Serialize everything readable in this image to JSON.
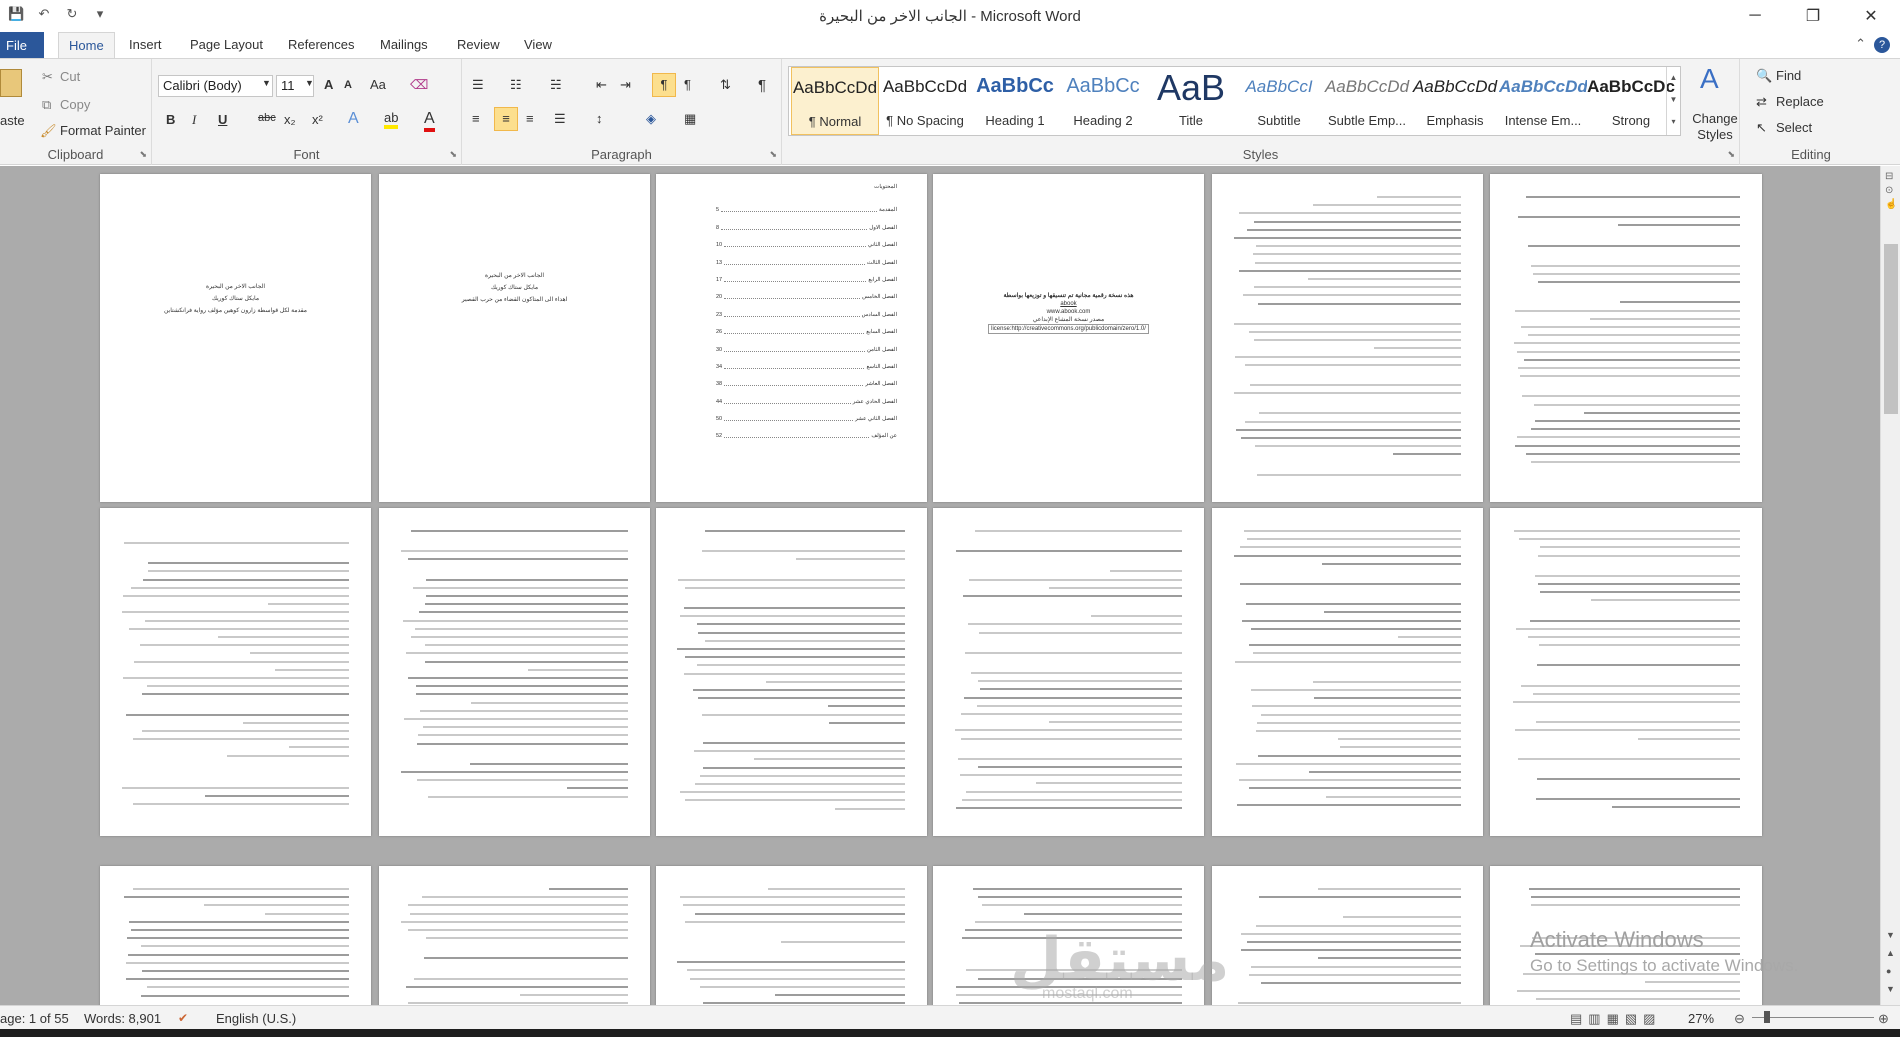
{
  "window": {
    "title": "الجانب الاخر من البحيرة  -  Microsoft Word",
    "controls": {
      "minimize": "─",
      "restore": "❐",
      "close": "✕"
    }
  },
  "qat": {
    "save_icon": "save-icon",
    "undo_icon": "undo-icon",
    "redo_icon": "redo-icon"
  },
  "tabs": {
    "file": "File",
    "home": "Home",
    "items": [
      "Insert",
      "Page Layout",
      "References",
      "Mailings",
      "Review",
      "View"
    ]
  },
  "ribbon": {
    "clipboard": {
      "paste": "aste",
      "cut": "Cut",
      "copy": "Copy",
      "format_painter": "Format Painter",
      "label": "Clipboard"
    },
    "font": {
      "font_name": "Calibri (Body)",
      "font_size": "11",
      "bold": "B",
      "italic": "I",
      "underline": "U",
      "strike": "abc",
      "subscript": "x₂",
      "superscript": "x²",
      "grow": "A",
      "shrink": "A",
      "case": "Aa",
      "label": "Font"
    },
    "paragraph": {
      "label": "Paragraph",
      "show_marks": "¶"
    },
    "styles": {
      "items": [
        {
          "preview": "AaBbCcDd",
          "name": "¶ Normal",
          "selected": true
        },
        {
          "preview": "AaBbCcDd",
          "name": "¶ No Spacing"
        },
        {
          "preview": "AaBbCc",
          "name": "Heading 1"
        },
        {
          "preview": "AaBbCc",
          "name": "Heading 2"
        },
        {
          "preview": "AaB",
          "name": "Title"
        },
        {
          "preview": "AaBbCcI",
          "name": "Subtitle"
        },
        {
          "preview": "AaBbCcDd",
          "name": "Subtle Emp..."
        },
        {
          "preview": "AaBbCcDd",
          "name": "Emphasis"
        },
        {
          "preview": "AaBbCcDd",
          "name": "Intense Em..."
        },
        {
          "preview": "AaBbCcDc",
          "name": "Strong"
        }
      ],
      "change_styles": "Change Styles",
      "label": "Styles"
    },
    "editing": {
      "find": "Find",
      "replace": "Replace",
      "select": "Select",
      "label": "Editing"
    }
  },
  "document": {
    "title_page": {
      "line1": "الجانب الاخر من البحيرة",
      "line2": "مايكل ستاك كوريك",
      "line3": "مقدمة لكل قواسطة زارون كوهين مؤلف رواية فرانكشتاين"
    },
    "dedication_page": {
      "line1": "الجانب الاخر من البحيرة",
      "line2": "مايكل ستاك كوريك",
      "line3": "اهداء الى المتاكون القضاء من حرب القصير"
    },
    "toc_page": {
      "heading": "المحتويات",
      "entries": [
        {
          "label": "المقدمة",
          "page": "5"
        },
        {
          "label": "الفصل الاول",
          "page": "8"
        },
        {
          "label": "الفصل الثاني",
          "page": "10"
        },
        {
          "label": "الفصل الثالث",
          "page": "13"
        },
        {
          "label": "الفصل الرابع",
          "page": "17"
        },
        {
          "label": "الفصل الخامس",
          "page": "20"
        },
        {
          "label": "الفصل السادس",
          "page": "23"
        },
        {
          "label": "الفصل السابع",
          "page": "26"
        },
        {
          "label": "الفصل الثامن",
          "page": "30"
        },
        {
          "label": "الفصل التاسع",
          "page": "34"
        },
        {
          "label": "الفصل العاشر",
          "page": "38"
        },
        {
          "label": "الفصل الحادي عشر",
          "page": "44"
        },
        {
          "label": "الفصل الثاني عشر",
          "page": "50"
        },
        {
          "label": "عن المؤلف",
          "page": "52"
        }
      ]
    },
    "license_page": {
      "line1": "هذه نسخة رقمية مجانية تم تنسيقها و توزيعها بواسطة",
      "line2": "abook",
      "line3": "www.abook.com",
      "line4": "مصدر نسخة المشاع الإبداعي",
      "line5": "license:http://creativecommons.org/publicdomain/zero/1.0/"
    },
    "chapter_heading": "الفصل الاول"
  },
  "watermark": {
    "activate": "Activate Windows",
    "settings": "Go to Settings to activate Windows.",
    "logo": "مستقل",
    "logo_url": "mostaql.com"
  },
  "status": {
    "page": "age: 1 of 55",
    "words": "Words: 8,901",
    "language": "English (U.S.)",
    "zoom": "27%"
  }
}
